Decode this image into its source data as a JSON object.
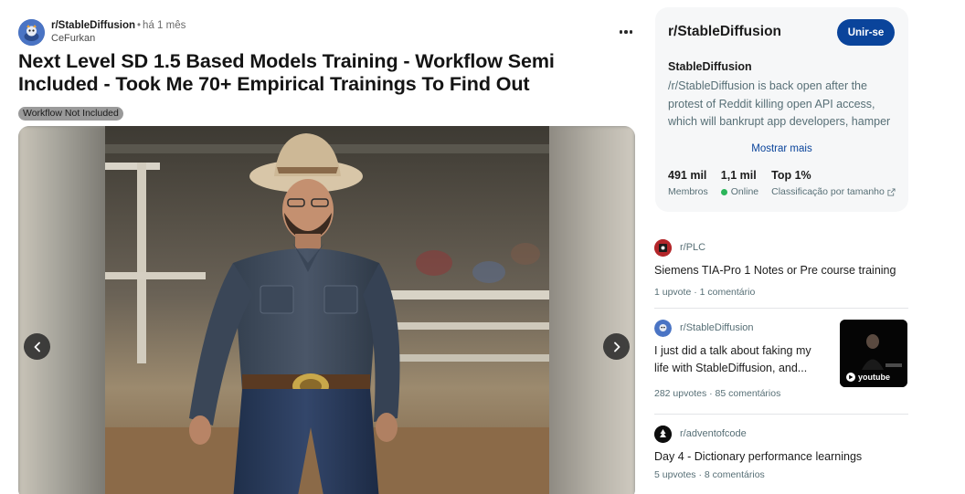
{
  "post": {
    "subreddit": "r/StableDiffusion",
    "separator": "•",
    "time": "há 1 mês",
    "author": "CeFurkan",
    "title": "Next Level SD 1.5 Based Models Training - Workflow Semi Included - Took Me 70+ Empirical Trainings To Find Out",
    "flair": "Workflow Not Included",
    "image_alt": "AI-generated photo of a cowboy in a denim shirt at a rodeo"
  },
  "sidebar": {
    "name": "r/StableDiffusion",
    "join_label": "Unir-se",
    "heading": "StableDiffusion",
    "description": "/r/StableDiffusion is back open after the protest of Reddit killing open API access, which will bankrupt app developers, hamper moderation, and exclude blind users from the site.",
    "show_more": "Mostrar mais",
    "stats": {
      "members_value": "491 mil",
      "members_label": "Membros",
      "online_value": "1,1 mil",
      "online_label": "Online",
      "rank_value": "Top 1%",
      "rank_label": "Classificação por tamanho"
    }
  },
  "related": [
    {
      "subreddit": "r/PLC",
      "title": "Siemens TIA-Pro 1 Notes or Pre course training",
      "stats": "1 upvote  ·  1 comentário"
    },
    {
      "subreddit": "r/StableDiffusion",
      "title": "I just did a talk about faking my life with StableDiffusion, and...",
      "stats": "282 upvotes  ·  85 comentários",
      "thumb_label": "youtube"
    },
    {
      "subreddit": "r/adventofcode",
      "title": "Day 4 - Dictionary performance learnings",
      "stats": "5 upvotes  ·  8 comentários"
    }
  ],
  "colors": {
    "join_button": "#0a449b",
    "online": "#2bb55a",
    "muted_text": "#576f76"
  }
}
